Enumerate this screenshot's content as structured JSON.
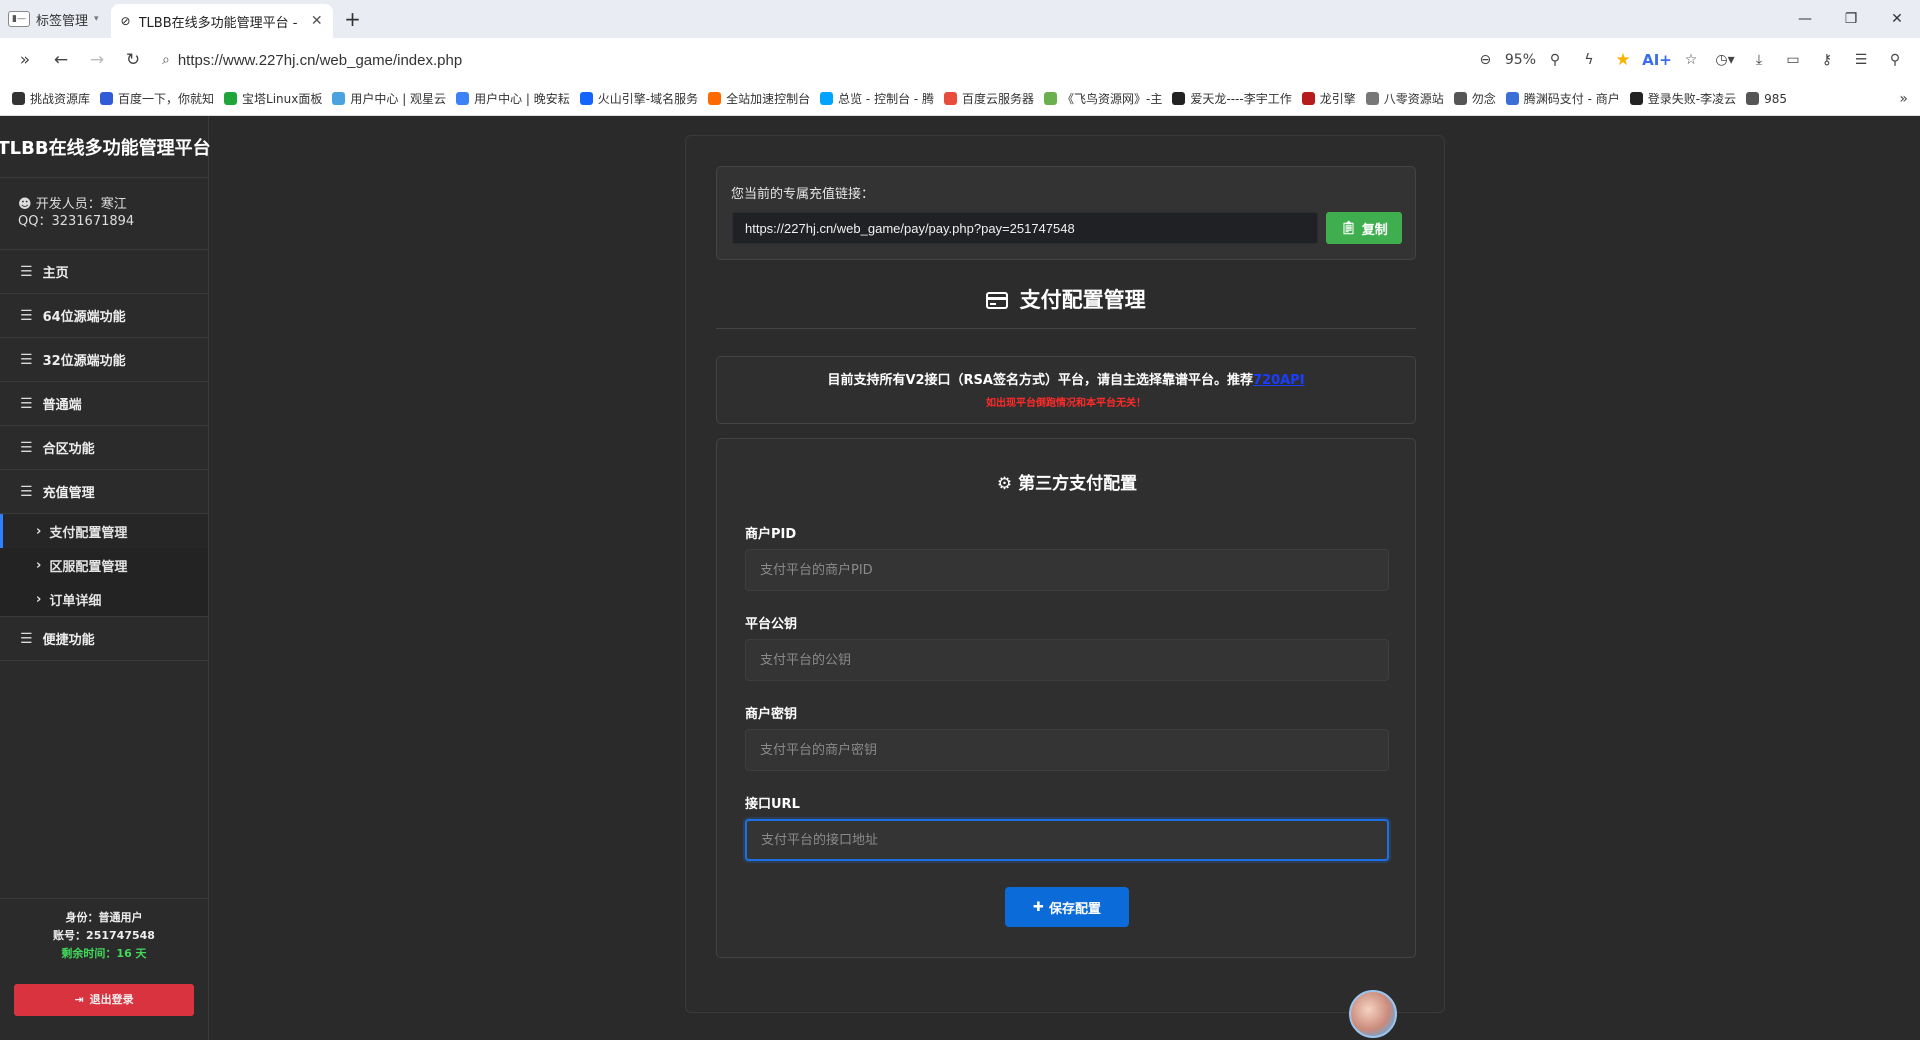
{
  "browser": {
    "tab_group_label": "标签管理",
    "active_tab_title": "TLBB在线多功能管理平台 - ...",
    "url": "https://www.227hj.cn/web_game/index.php",
    "zoom": "95%",
    "ai_label": "AI+"
  },
  "bookmarks": [
    {
      "label": "挑战资源库",
      "color": "#333333"
    },
    {
      "label": "百度一下，你就知",
      "color": "#2f5bd6"
    },
    {
      "label": "宝塔Linux面板",
      "color": "#20a53a"
    },
    {
      "label": "用户中心 | 观星云",
      "color": "#4aa3df"
    },
    {
      "label": "用户中心 | 晚安耘",
      "color": "#3b82f6"
    },
    {
      "label": "火山引擎-域名服务",
      "color": "#1664ff"
    },
    {
      "label": "全站加速控制台",
      "color": "#ff6a00"
    },
    {
      "label": "总览 - 控制台 - 腾",
      "color": "#00a4ff"
    },
    {
      "label": "百度云服务器",
      "color": "#e94b3c"
    },
    {
      "label": "《飞鸟资源网》-主",
      "color": "#6ab04c"
    },
    {
      "label": "爱天龙----李宇工作",
      "color": "#222222"
    },
    {
      "label": "龙引擎",
      "color": "#b71c1c"
    },
    {
      "label": "八零资源站",
      "color": "#777777"
    },
    {
      "label": "勿念",
      "color": "#555555"
    },
    {
      "label": "腾渊码支付 - 商户",
      "color": "#3b6fd8"
    },
    {
      "label": "登录失败-李凌云",
      "color": "#222222"
    },
    {
      "label": "985",
      "color": "#555555"
    }
  ],
  "sidebar": {
    "brand": "TLBB在线多功能管理平台",
    "developer": "开发人员：寒江",
    "qq": "QQ：3231671894",
    "menu": [
      {
        "label": "主页"
      },
      {
        "label": "64位源端功能"
      },
      {
        "label": "32位源端功能"
      },
      {
        "label": "普通端"
      },
      {
        "label": "合区功能"
      },
      {
        "label": "充值管理"
      }
    ],
    "submenu": [
      {
        "label": "支付配置管理"
      },
      {
        "label": "区服配置管理"
      },
      {
        "label": "订单详细"
      }
    ],
    "menu_after": {
      "label": "便捷功能"
    },
    "footer": {
      "identity": "身份：普通用户",
      "account": "账号：251747548",
      "remaining": "剩余时间：16 天",
      "logout": "退出登录"
    }
  },
  "main": {
    "link_label": "您当前的专属充值链接：",
    "link_value": "https://227hj.cn/web_game/pay/pay.php?pay=251747548",
    "copy_label": "复制",
    "section_title": "支付配置管理",
    "notice_main": "目前支持所有V2接口（RSA签名方式）平台，请自主选择靠谱平台。推荐",
    "notice_link": "720API",
    "notice_warn": "如出现平台倒跑情况和本平台无关！",
    "form_title": "第三方支付配置",
    "fields": [
      {
        "label": "商户PID",
        "placeholder": "支付平台的商户PID",
        "value": ""
      },
      {
        "label": "平台公钥",
        "placeholder": "支付平台的公钥",
        "value": ""
      },
      {
        "label": "商户密钥",
        "placeholder": "支付平台的商户密钥",
        "value": ""
      },
      {
        "label": "接口URL",
        "placeholder": "支付平台的接口地址",
        "value": ""
      }
    ],
    "save_label": "保存配置"
  },
  "colors": {
    "accent_blue": "#0b6bd8",
    "copy_green": "#3fae4f",
    "logout_red": "#d93340",
    "remaining_green": "#42d95b",
    "warn_red": "#ff2a2a"
  },
  "icons": {
    "menu": "list-icon",
    "sub": "chevron-right-icon",
    "section": "credit-card-icon",
    "form": "gear-icon",
    "copy": "clipboard-icon",
    "save": "plus-icon",
    "logout": "sign-out-icon"
  }
}
